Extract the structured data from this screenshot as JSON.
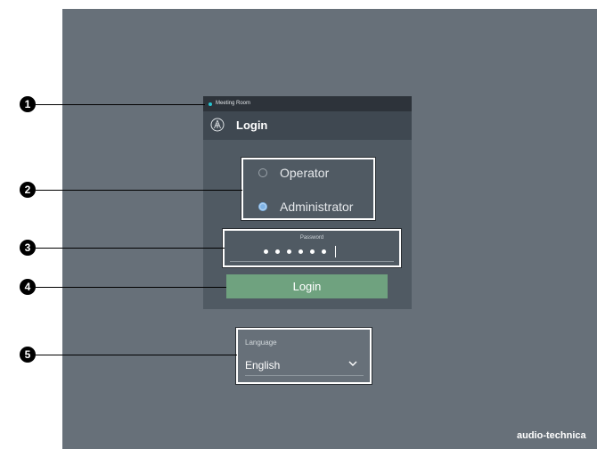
{
  "dialog": {
    "room_name": "Meeting Room",
    "title": "Login",
    "roles": [
      {
        "label": "Operator",
        "selected": false
      },
      {
        "label": "Administrator",
        "selected": true
      }
    ],
    "password": {
      "label": "Password",
      "masked_length": 6
    },
    "login_button": "Login"
  },
  "language": {
    "label": "Language",
    "value": "English"
  },
  "callouts": [
    "1",
    "2",
    "3",
    "4",
    "5"
  ],
  "brand": "audio-technica",
  "colors": {
    "background": "#677079",
    "dialog": "#505a63",
    "titlebar": "#2d333a",
    "status_dot": "#27c4d0",
    "login_button": "#6fa27f",
    "radio_selected": "#7fb4e6"
  },
  "icons": [
    "microphone-logo-icon",
    "chevron-down-icon"
  ]
}
